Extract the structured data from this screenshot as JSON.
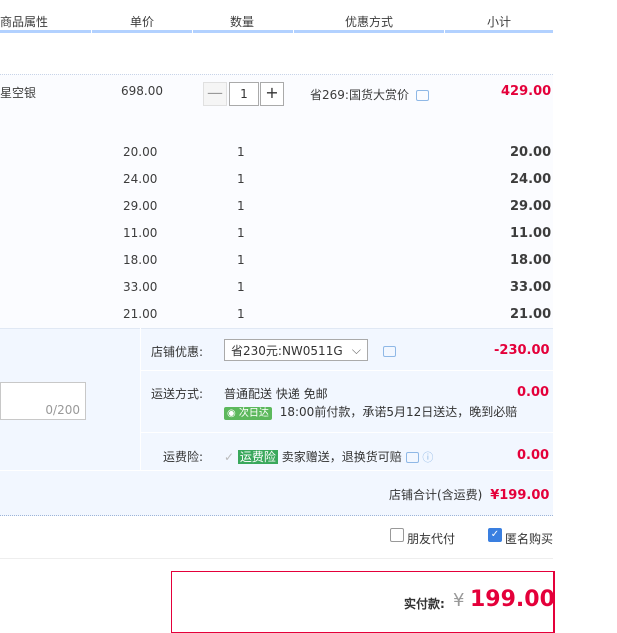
{
  "header": {
    "col_attr": "商品属性",
    "col_price": "单价",
    "col_qty": "数量",
    "col_promo": "优惠方式",
    "col_subtotal": "小计"
  },
  "main_item": {
    "attr": "星空银",
    "price": "698.00",
    "qty": "1",
    "minus": "—",
    "plus": "+",
    "promo": "省269:国货大赏价",
    "subtotal": "429.00"
  },
  "sub_items": [
    {
      "price": "20.00",
      "qty": "1",
      "subtotal": "20.00"
    },
    {
      "price": "24.00",
      "qty": "1",
      "subtotal": "24.00"
    },
    {
      "price": "29.00",
      "qty": "1",
      "subtotal": "29.00"
    },
    {
      "price": "11.00",
      "qty": "1",
      "subtotal": "11.00"
    },
    {
      "price": "18.00",
      "qty": "1",
      "subtotal": "18.00"
    },
    {
      "price": "33.00",
      "qty": "1",
      "subtotal": "33.00"
    },
    {
      "price": "21.00",
      "qty": "1",
      "subtotal": "21.00"
    }
  ],
  "shop_discount": {
    "label": "店铺优惠:",
    "selected": "省230元:NW0511G",
    "amount": "-230.00"
  },
  "shipping": {
    "label": "运送方式:",
    "method": "普通配送 快递 免邮",
    "badge": "次日达",
    "promise": "18:00前付款，承诺5月12日送达，晚到必赔",
    "amount": "0.00"
  },
  "memo": {
    "counter": "0/200"
  },
  "insurance": {
    "label": "运费险:",
    "tag": "运费险",
    "text": "卖家赠送，退换货可赔",
    "amount": "0.00"
  },
  "shop_total": {
    "label": "店铺合计(含运费)",
    "amount": "¥199.00"
  },
  "options": {
    "friend_pay": "朋友代付",
    "anonymous": "匿名购买"
  },
  "payment": {
    "label": "实付款:",
    "currency": "¥",
    "amount": "199.00"
  },
  "colors": {
    "accent_red": "#e4003a",
    "header_line": "#b2d1ff",
    "service_bg": "#f2f7ff"
  }
}
